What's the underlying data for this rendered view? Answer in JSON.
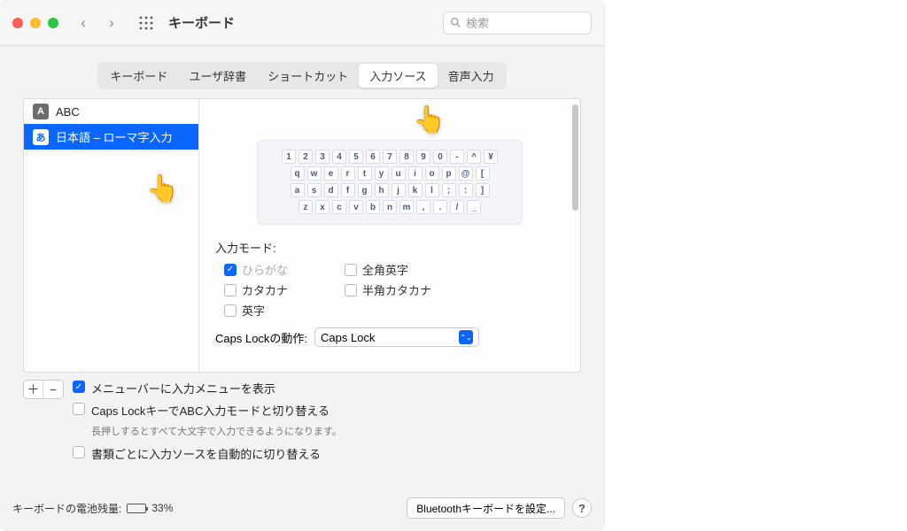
{
  "window": {
    "title": "キーボード"
  },
  "search": {
    "placeholder": "検索"
  },
  "tabs": [
    {
      "label": "キーボード"
    },
    {
      "label": "ユーザ辞書"
    },
    {
      "label": "ショートカット"
    },
    {
      "label": "入力ソース"
    },
    {
      "label": "音声入力"
    }
  ],
  "active_tab": 3,
  "sources": [
    {
      "badge": "A",
      "label": "ABC",
      "selected": false
    },
    {
      "badge": "あ",
      "label": "日本語 – ローマ字入力",
      "selected": true
    }
  ],
  "keyboard_rows": [
    [
      "1",
      "2",
      "3",
      "4",
      "5",
      "6",
      "7",
      "8",
      "9",
      "0",
      "-",
      "^",
      "¥"
    ],
    [
      "q",
      "w",
      "e",
      "r",
      "t",
      "y",
      "u",
      "i",
      "o",
      "p",
      "@",
      "["
    ],
    [
      "a",
      "s",
      "d",
      "f",
      "g",
      "h",
      "j",
      "k",
      "l",
      ";",
      ":",
      "]"
    ],
    [
      "z",
      "x",
      "c",
      "v",
      "b",
      "n",
      "m",
      ",",
      ".",
      "/",
      "_"
    ]
  ],
  "input_mode_label": "入力モード:",
  "modes": {
    "hiragana": {
      "label": "ひらがな",
      "checked": true,
      "disabled": true
    },
    "zenkaku_eiji": {
      "label": "全角英字",
      "checked": false
    },
    "katakana": {
      "label": "カタカナ",
      "checked": false
    },
    "hankaku_katakana": {
      "label": "半角カタカナ",
      "checked": false
    },
    "eiji": {
      "label": "英字",
      "checked": false
    }
  },
  "caps_lock": {
    "label": "Caps Lockの動作:",
    "value": "Caps Lock"
  },
  "options": {
    "show_menu": {
      "label": "メニューバーに入力メニューを表示",
      "checked": true
    },
    "caps_abc": {
      "label": "Caps LockキーでABC入力モードと切り替える",
      "checked": false,
      "hint": "長押しするとすべて大文字で入力できるようになります。"
    },
    "auto_switch": {
      "label": "書類ごとに入力ソースを自動的に切り替える",
      "checked": false
    }
  },
  "battery": {
    "label": "キーボードの電池残量:",
    "percent": "33%"
  },
  "bluetooth_button": "Bluetoothキーボードを設定...",
  "help": "?"
}
